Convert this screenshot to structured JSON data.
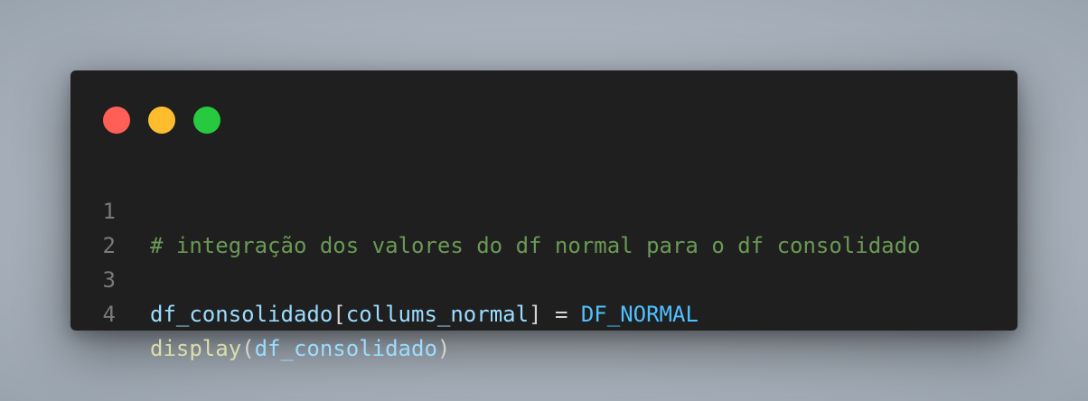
{
  "window": {
    "controls": [
      {
        "name": "close",
        "color": "#ff5f56"
      },
      {
        "name": "minimize",
        "color": "#ffbd2e"
      },
      {
        "name": "maximize",
        "color": "#27c93f"
      }
    ]
  },
  "code": {
    "lines": [
      {
        "number": "1",
        "tokens": [
          {
            "text": "# integração dos valores do df normal para o df consolidado",
            "type": "comment"
          }
        ]
      },
      {
        "number": "2",
        "tokens": []
      },
      {
        "number": "3",
        "tokens": [
          {
            "text": "df_consolidado",
            "type": "var"
          },
          {
            "text": "[",
            "type": "punct"
          },
          {
            "text": "collums_normal",
            "type": "var"
          },
          {
            "text": "] = ",
            "type": "punct"
          },
          {
            "text": "DF_NORMAL",
            "type": "const"
          }
        ]
      },
      {
        "number": "4",
        "tokens": [
          {
            "text": "display",
            "type": "func"
          },
          {
            "text": "(",
            "type": "punct"
          },
          {
            "text": "df_consolidado",
            "type": "var"
          },
          {
            "text": ")",
            "type": "punct"
          }
        ]
      }
    ]
  },
  "colors": {
    "comment": "#6a9955",
    "var": "#9cdcfe",
    "punct": "#d4d4d4",
    "const": "#4fc1ff",
    "func": "#dcdcaa",
    "line_number": "#7a7a7a",
    "background": "#1f1f1f"
  }
}
